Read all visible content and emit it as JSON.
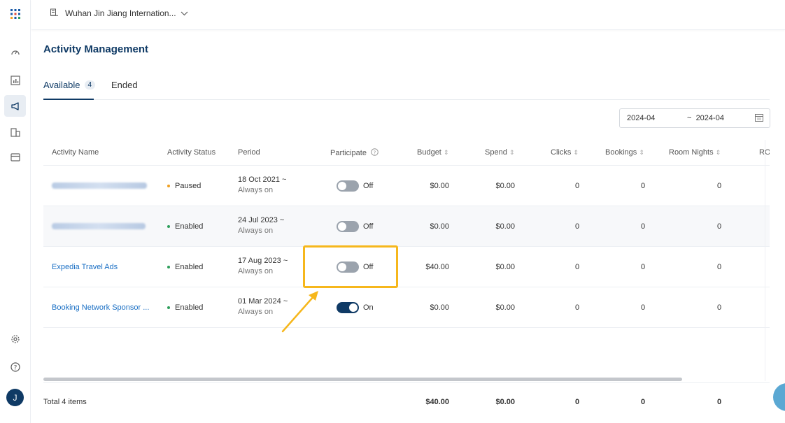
{
  "header": {
    "hotel_name": "Wuhan Jin Jiang Internation...",
    "page_title": "Activity Management"
  },
  "tabs": [
    {
      "label": "Available",
      "count": "4"
    },
    {
      "label": "Ended"
    }
  ],
  "date_range": {
    "start": "2024-04",
    "separator": "~",
    "end": "2024-04"
  },
  "table": {
    "columns": [
      "Activity Name",
      "Activity Status",
      "Period",
      "Participate",
      "Budget",
      "Spend",
      "Clicks",
      "Bookings",
      "Room Nights",
      "RO"
    ],
    "rows": [
      {
        "name": "",
        "name_blurred": true,
        "status": "Paused",
        "status_color": "#f0a020",
        "period_start": "18 Oct 2021 ~",
        "period_end": "Always on",
        "participate": "Off",
        "participate_on": false,
        "budget": "$0.00",
        "spend": "$0.00",
        "clicks": "0",
        "bookings": "0",
        "room_nights": "0"
      },
      {
        "name": "",
        "name_blurred": true,
        "status": "Enabled",
        "status_color": "#2e9e5b",
        "period_start": "24 Jul 2023 ~",
        "period_end": "Always on",
        "participate": "Off",
        "participate_on": false,
        "budget": "$0.00",
        "spend": "$0.00",
        "clicks": "0",
        "bookings": "0",
        "room_nights": "0"
      },
      {
        "name": "Expedia Travel Ads",
        "name_blurred": false,
        "status": "Enabled",
        "status_color": "#2e9e5b",
        "period_start": "17 Aug 2023 ~",
        "period_end": "Always on",
        "participate": "Off",
        "participate_on": false,
        "budget": "$40.00",
        "spend": "$0.00",
        "clicks": "0",
        "bookings": "0",
        "room_nights": "0"
      },
      {
        "name": "Booking Network Sponsor ...",
        "name_blurred": false,
        "status": "Enabled",
        "status_color": "#2e9e5b",
        "period_start": "01 Mar 2024 ~",
        "period_end": "Always on",
        "participate": "On",
        "participate_on": true,
        "budget": "$0.00",
        "spend": "$0.00",
        "clicks": "0",
        "bookings": "0",
        "room_nights": "0"
      }
    ]
  },
  "footer": {
    "total_label": "Total 4 items",
    "budget": "$40.00",
    "spend": "$0.00",
    "clicks": "0",
    "bookings": "0",
    "room_nights": "0"
  },
  "colors": {
    "brand": "#0f3a65",
    "link": "#1a6fc4",
    "highlight": "#f6b71c"
  },
  "sidebar_icons": [
    "apps-grid-icon",
    "dashboard-gauge-icon",
    "report-chart-icon",
    "campaign-megaphone-icon",
    "property-building-icon",
    "billing-card-icon",
    "settings-gear-icon",
    "help-circle-icon"
  ],
  "user": {
    "initial": "J"
  }
}
